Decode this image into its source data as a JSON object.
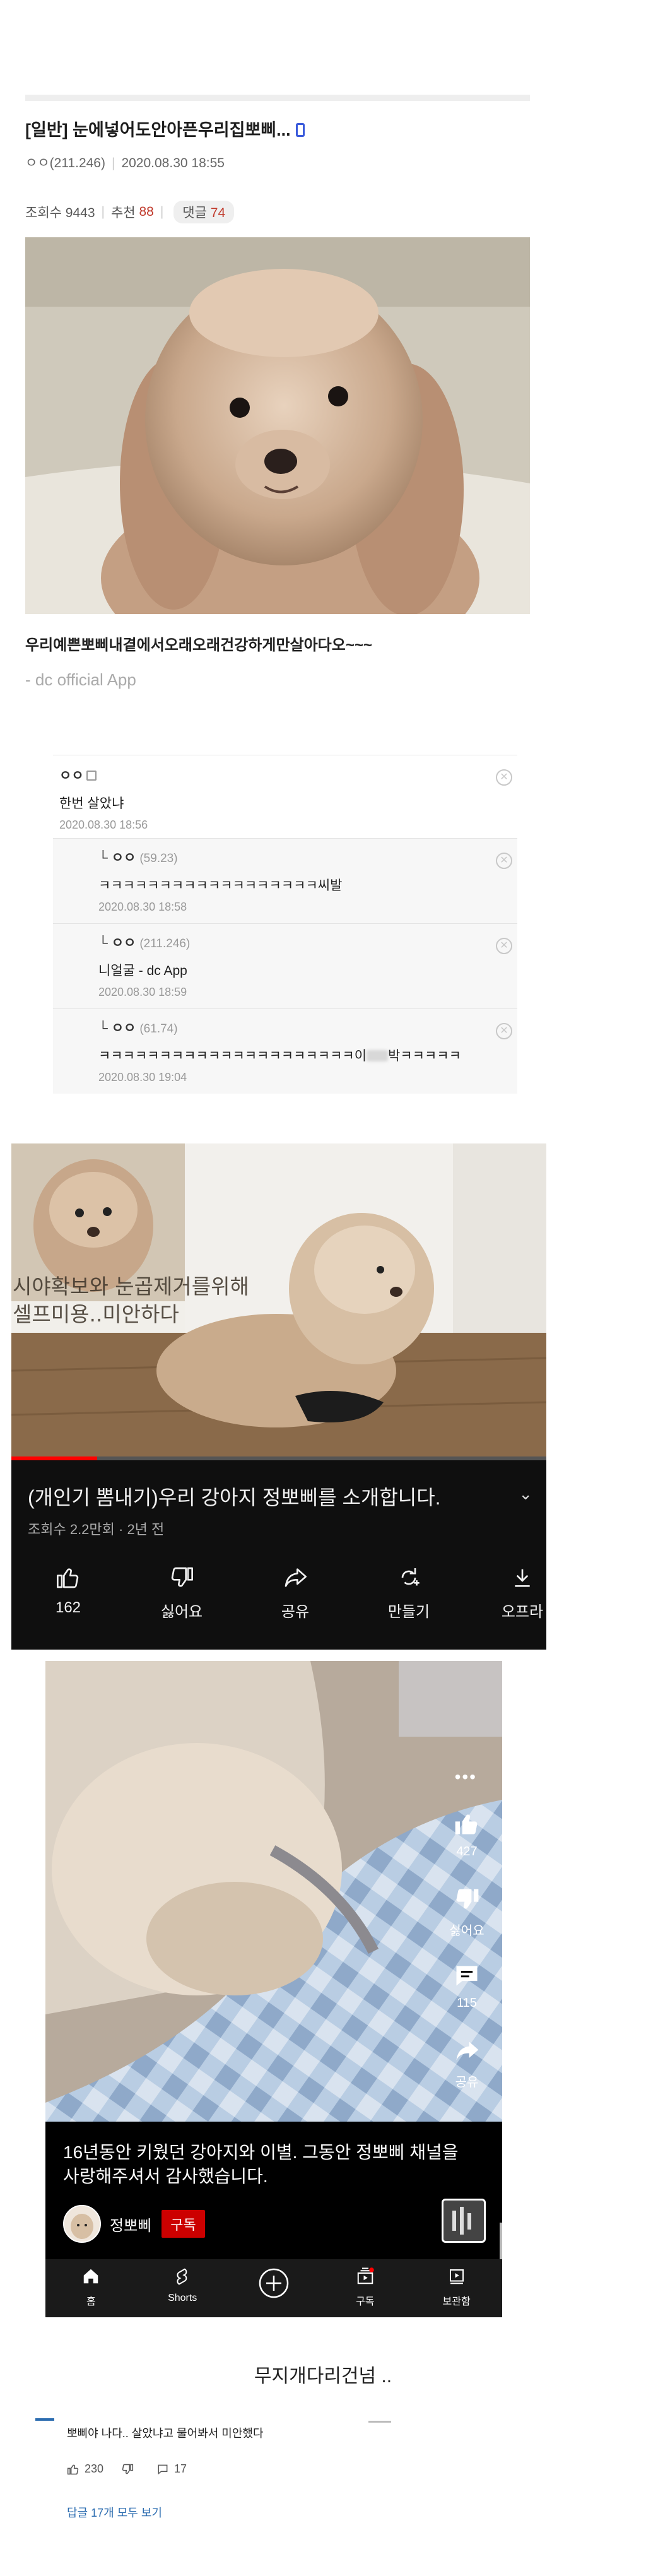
{
  "post": {
    "title": "[일반] 눈에넣어도안아픈우리집뽀삐...",
    "author": "ㅇㅇ(211.246)",
    "date": "2020.08.30 18:55",
    "views_label": "조회수 9443",
    "recommend_label": "추천",
    "recommend_count": "88",
    "comment_label": "댓글",
    "comment_count": "74",
    "body": "우리예쁜뽀삐내곁에서오래오래건강하게만살아다오~~~",
    "footer": "- dc official App"
  },
  "comments": [
    {
      "nick": "ㅇㅇ",
      "ip": "",
      "body": "한번 살았냐",
      "date": "2020.08.30 18:56"
    },
    {
      "nick": "ㅇㅇ",
      "ip": "(59.23)",
      "body": "ㅋㅋㅋㅋㅋㅋㅋㅋㅋㅋㅋㅋㅋㅋㅋㅋㅋㅋ씨발",
      "date": "2020.08.30 18:58"
    },
    {
      "nick": "ㅇㅇ",
      "ip": "(211.246)",
      "body": "니얼굴 - dc App",
      "date": "2020.08.30 18:59"
    },
    {
      "nick": "ㅇㅇ",
      "ip": "(61.74)",
      "body_a": "ㅋㅋㅋㅋㅋㅋㅋㅋㅋㅋㅋㅋㅋㅋㅋㅋㅋㅋㅋㅋㅋ이",
      "body_b": "박ㅋㅋㅋㅋㅋ",
      "date": "2020.08.30 19:04"
    }
  ],
  "video": {
    "overlay_line1": "시야확보와 눈곱제거를위해",
    "overlay_line2": "셀프미용..미안하다",
    "progress_fraction": 0.16,
    "title": "(개인기 뽐내기)우리 강아지 정뽀삐를 소개합니다.",
    "meta": "조회수 2.2만회 · 2년 전",
    "actions": [
      {
        "label": "162",
        "icon": "thumbs-up-icon"
      },
      {
        "label": "싫어요",
        "icon": "thumbs-down-icon"
      },
      {
        "label": "공유",
        "icon": "share-icon"
      },
      {
        "label": "만들기",
        "icon": "remix-icon"
      },
      {
        "label": "오프라",
        "icon": "download-icon"
      }
    ]
  },
  "shorts": {
    "like_count": "427",
    "dislike_label": "싫어요",
    "comment_count": "115",
    "share_label": "공유",
    "caption": "16년동안 키웠던 강아지와 이별. 그동안 정뽀삐 채널을 사랑해주셔서 감사했습니다.",
    "channel": "정뽀삐",
    "subscribe": "구독",
    "nav": [
      "홈",
      "Shorts",
      "",
      "구독",
      "보관함"
    ]
  },
  "bottom": {
    "heading": "무지개다리건넘 ..",
    "comment_text": "뽀삐야 나다.. 살았냐고 물어봐서 미안했다",
    "like_count": "230",
    "reply_count": "17",
    "view_replies": "답글 17개 모두 보기"
  },
  "colors": {
    "accent_red": "#c0392b",
    "youtube_red": "#ff0000",
    "link_blue": "#2b6cb0"
  }
}
